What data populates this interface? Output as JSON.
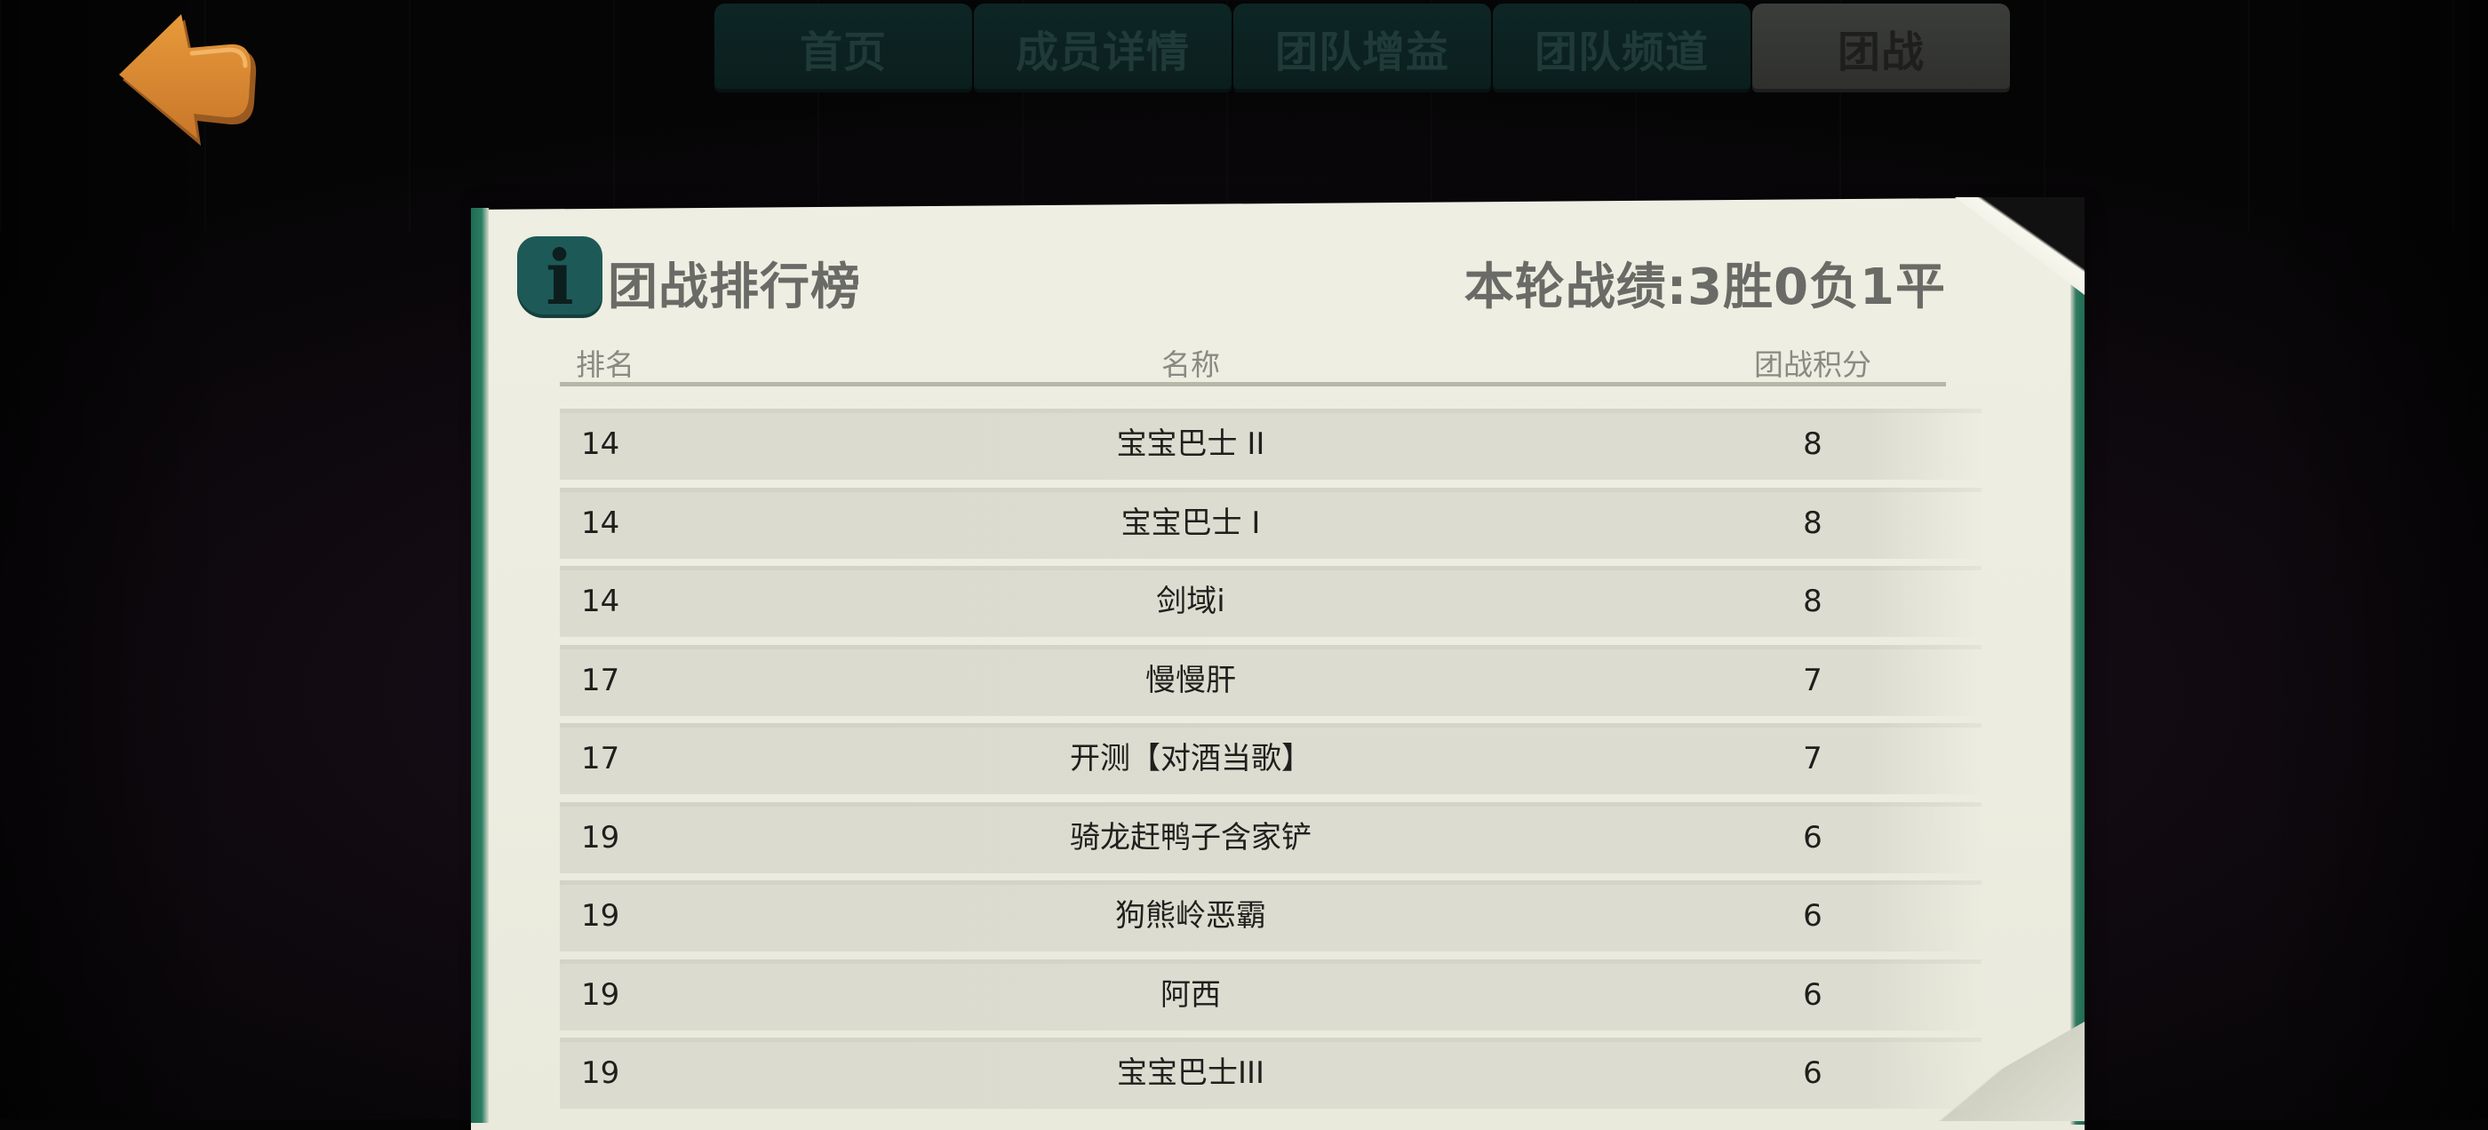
{
  "nav": {
    "back_icon": "back-arrow-icon",
    "tabs": [
      {
        "label": "首页",
        "active": false
      },
      {
        "label": "成员详情",
        "active": false
      },
      {
        "label": "团队增益",
        "active": false
      },
      {
        "label": "团队频道",
        "active": false
      },
      {
        "label": "团战",
        "active": true
      }
    ]
  },
  "panel": {
    "info_icon": "info-icon",
    "title": "团战排行榜",
    "round_record": "本轮战绩:3胜0负1平",
    "columns": {
      "rank": "排名",
      "name": "名称",
      "score": "团战积分"
    },
    "rows": [
      {
        "rank": "14",
        "name": "宝宝巴士 II",
        "score": "8"
      },
      {
        "rank": "14",
        "name": "宝宝巴士 I",
        "score": "8"
      },
      {
        "rank": "14",
        "name": "剑域i",
        "score": "8"
      },
      {
        "rank": "17",
        "name": "慢慢肝",
        "score": "7"
      },
      {
        "rank": "17",
        "name": "开测【对酒当歌】",
        "score": "7"
      },
      {
        "rank": "19",
        "name": "骑龙赶鸭子含家铲",
        "score": "6"
      },
      {
        "rank": "19",
        "name": "狗熊岭恶霸",
        "score": "6"
      },
      {
        "rank": "19",
        "name": "阿西",
        "score": "6"
      },
      {
        "rank": "19",
        "name": "宝宝巴士III",
        "score": "6"
      }
    ]
  },
  "colors": {
    "accent_teal": "#1d5a57",
    "back_button_orange": "#d9892f",
    "paper": "#ececdf",
    "row_bg": "#dcdcd0"
  }
}
